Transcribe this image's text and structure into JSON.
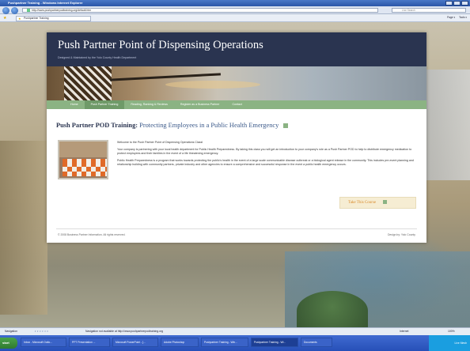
{
  "browser": {
    "title": "Pushpartner Training - Windows Internet Explorer",
    "url": "http://www.pushpartnerpodtraining.org/default.htm",
    "search_placeholder": "Live Search",
    "tab_label": "Pushpartner Training",
    "tools": [
      "Page ▾",
      "Tools ▾"
    ]
  },
  "site": {
    "title": "Push Partner Point of Dispensing Operations",
    "subtitle": "Designed & Maintained by the Yolo County Health Department",
    "nav": [
      "Home",
      "Push Partner Training",
      "Reading, Ranking & Reviews",
      "Register as a Business Partner",
      "Contact"
    ],
    "headline_bold": "Push Partner POD Training:",
    "headline_rest": "Protecting Employees in a Public Health Emergency",
    "paragraphs": [
      "Welcome to the Push Partner Point of Dispensing Operations Class!",
      "Your company is partnering with your local health department for Public Health Preparedness. By taking this class you will get an introduction to your company's role as a Push Partner POD to help to distribute emergency medication to protect employees and their families in the event of a life threatening emergency.",
      "Public Health Preparedness is a program that works towards protecting the public's health in the event of a large scale communicable disease outbreak or a biological agent release in the community. This includes pre-event planning and relationship building with community partners, private industry and other agencies to ensure a comprehensive and successful response in the event a public health emergency occurs."
    ],
    "cta": "Take This Course",
    "footer_left": "© 2008 Business Partner Information. All rights reserved.",
    "footer_right": "Design by: Yolo County"
  },
  "status": {
    "nav": "Navigation",
    "message": "Navigation not available at http://www.pushpartnerpodtraining.org",
    "zone": "Internet",
    "zoom": "100%"
  },
  "taskbar": {
    "start": "start",
    "tasks": [
      "Inbox - Microsoft Outlo...",
      "PPT Presentation ...",
      "Microsoft PowerPoint - [...",
      "Adobe Photoshop",
      "Pushpartner Training - Win...",
      "Pushpartner Training - Wi...",
      "Documents"
    ],
    "active_index": 5,
    "clock": "Live Mesh"
  },
  "colors": {
    "header": "#2a3450",
    "nav_green": "#8bb383",
    "cta_text": "#d98a2a"
  }
}
